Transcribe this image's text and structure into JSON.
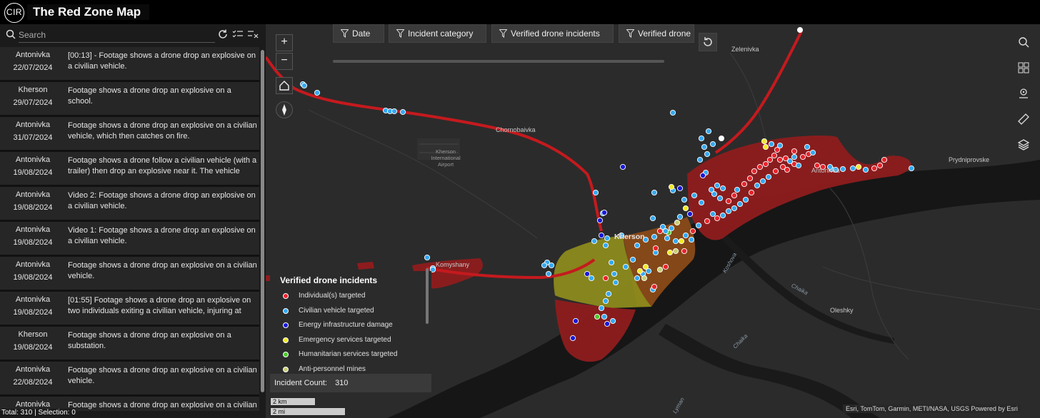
{
  "header": {
    "logo_text": "CIR",
    "title": "The Red Zone Map"
  },
  "sidebar": {
    "search_placeholder": "Search",
    "items": [
      {
        "place": "Antonivka",
        "date": "22/07/2024",
        "desc": "[00:13] - Footage shows a drone drop an explosive on a civilian vehicle."
      },
      {
        "place": "Kherson",
        "date": "29/07/2024",
        "desc": "Footage shows a drone drop an explosive on a school."
      },
      {
        "place": "Antonivka",
        "date": "31/07/2024",
        "desc": "Footage shows a drone drop an explosive on a civilian vehicle, which then catches on fire."
      },
      {
        "place": "Antonivka",
        "date": "19/08/2024",
        "desc": "Footage shows a drone follow a civilian vehicle (with a trailer) then drop an explosive near it. The vehicle"
      },
      {
        "place": "Antonivka",
        "date": "19/08/2024",
        "desc": "Video 2: Footage shows a drone drop an explosive on a civilian vehicle."
      },
      {
        "place": "Antonivka",
        "date": "19/08/2024",
        "desc": "Video 1: Footage shows a drone drop an explosive on a civilian vehicle."
      },
      {
        "place": "Antonivka",
        "date": "19/08/2024",
        "desc": "Footage shows a drone drop an explosive on a civilian vehicle."
      },
      {
        "place": "Antonivka",
        "date": "19/08/2024",
        "desc": "[01:55] Footage shows a drone drop an explosive on two individuals exiting a civilian vehicle, injuring at"
      },
      {
        "place": "Kherson",
        "date": "19/08/2024",
        "desc": "Footage shows a drone drop an explosive on a substation."
      },
      {
        "place": "Antonivka",
        "date": "22/08/2024",
        "desc": "Footage shows a drone drop an explosive on a civilian vehicle."
      },
      {
        "place": "Antonivka",
        "date": "",
        "desc": "Footage shows a drone drop an explosive on a civilian vehicle and an individual who appears to be wearing"
      }
    ],
    "footer": "Total: 310 | Selection: 0"
  },
  "map": {
    "filters": [
      "Date",
      "Incident category",
      "Verified drone incidents",
      "Verified drone"
    ],
    "zoom_in": "+",
    "zoom_out": "−",
    "labels": {
      "zelenivka": "Zelenivka",
      "chornobaivka": "Chornobaivka",
      "airport": "Kherson International Airport",
      "kherson": "Kherson",
      "antonivka": "Antonivka",
      "prydniprovske": "Prydniprovske",
      "komyshany": "Komyshany",
      "oleshky": "Oleshky",
      "koshova": "Koshova",
      "chaika1": "Chaika",
      "chaika2": "Chaika",
      "lyman": "Lyman"
    },
    "legend": {
      "title": "Verified drone incidents",
      "items": [
        {
          "label": "Individual(s) targeted",
          "color": "#e8242c"
        },
        {
          "label": "Civilian vehicle targeted",
          "color": "#36a9f2"
        },
        {
          "label": "Energy infrastructure damage",
          "color": "#1a1ad8"
        },
        {
          "label": "Emergency services targeted",
          "color": "#f2ea2a"
        },
        {
          "label": "Humanitarian services targeted",
          "color": "#4cc92e"
        },
        {
          "label": "Anti-personnel mines",
          "color": "#c9cf7a"
        }
      ]
    },
    "incident_count_label": "Incident Count:",
    "incident_count": "310",
    "scale_km": "2 km",
    "scale_mi": "2 mi",
    "attribution": "Esri, TomTom, Garmin, METI/NASA, USGS    Powered by Esri"
  },
  "colors": {
    "zone_red": "#8e1c1e",
    "zone_orange": "#8a4a17",
    "zone_yellow": "#8c8a1c",
    "road_red": "#c41a1e",
    "water": "#161616",
    "land": "#2b2b2b"
  }
}
